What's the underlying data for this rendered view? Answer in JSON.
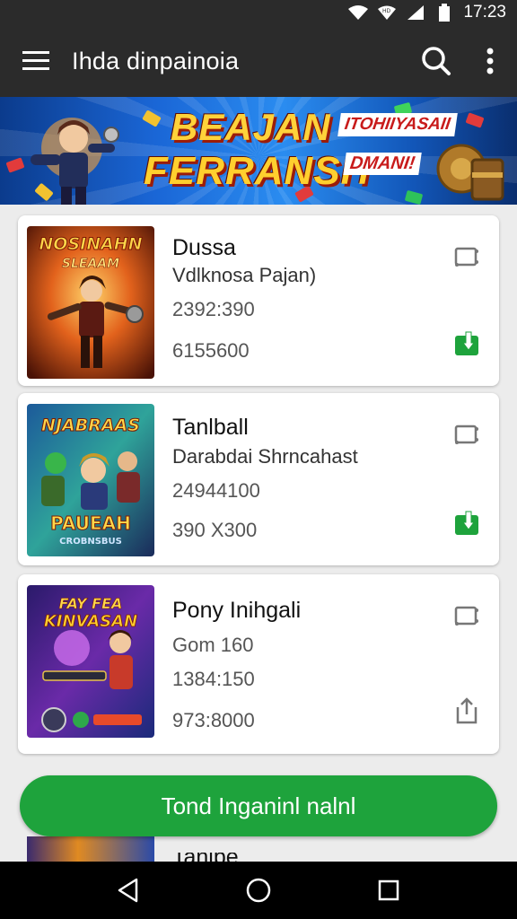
{
  "status": {
    "time": "17:23"
  },
  "app_bar": {
    "title": "Ihda dinpainoia",
    "menu_icon": "hamburger-menu-icon",
    "search_icon": "search-icon",
    "more_icon": "more-vert-icon"
  },
  "banner": {
    "line1": "BEAJAN",
    "line2": "FERRANSH",
    "tag1": "ITOHIIYASAII",
    "tag2": "DMANI!"
  },
  "cards": [
    {
      "thumb_text_top": "NOSINAHN",
      "thumb_text_mid": "SLEAAM",
      "title": "Dussa",
      "subtitle": "Vdlknosa Pajan)",
      "num1": "2392:390",
      "num2": "6155600",
      "cast_icon": "cast-icon",
      "action_icon": "download-icon",
      "action_color": "#1ea33c"
    },
    {
      "thumb_text_top": "NJABRAAS",
      "thumb_text_mid": "PAUEAH",
      "thumb_text_low": "CROBNSBUS",
      "title": "Tanlball",
      "subtitle": "Darabdai Shrncahast",
      "num1": "24944100",
      "num2": "390 X300",
      "cast_icon": "cast-icon",
      "action_icon": "download-icon",
      "action_color": "#1ea33c"
    },
    {
      "thumb_text_top": "FAY FEA",
      "thumb_text_mid": "KINVASAN",
      "title": "Pony Inihgali",
      "subtitle": "Gom 160",
      "num1": "1384:150",
      "num2": "973:8000",
      "cast_icon": "cast-icon",
      "action_icon": "share-icon",
      "action_color": "#777777"
    }
  ],
  "cta": {
    "label": "Tond Inganinl nalnl"
  },
  "peek": {
    "title": "Tanlbe"
  },
  "nav": {
    "back_icon": "back-triangle-icon",
    "home_icon": "home-circle-icon",
    "recents_icon": "recents-square-icon"
  }
}
